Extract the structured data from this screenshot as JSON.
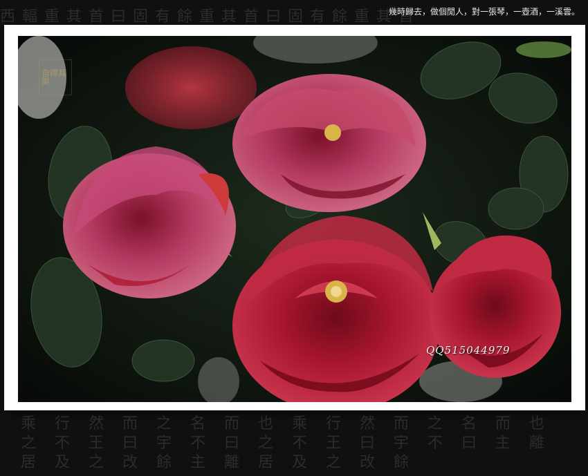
{
  "caption": "幾時歸去，做個閒人，對一張琴，一壺酒，一溪雲。",
  "watermark": "QQ515044979",
  "seal_text": "自得其樂",
  "background_text_top": "西輻重其首曰固有餘重其首曰固有餘重其首",
  "background_text_bottom": "乘 行 然 而 之 名 而 也 乘 行 然 而 之 名 而 也 之 不 王 曰 宇 不 曰 之 不 王 曰 宇 不 曰 主 離 居 及 之 改 餘 主 離 居 及 之 改 餘",
  "photo": {
    "subject": "red roses",
    "colors": {
      "rose_deep": "#8e0f22",
      "rose_mid": "#c0233a",
      "rose_light": "#d0556e",
      "leaf": "#233424",
      "bg": "#0f140f"
    }
  }
}
